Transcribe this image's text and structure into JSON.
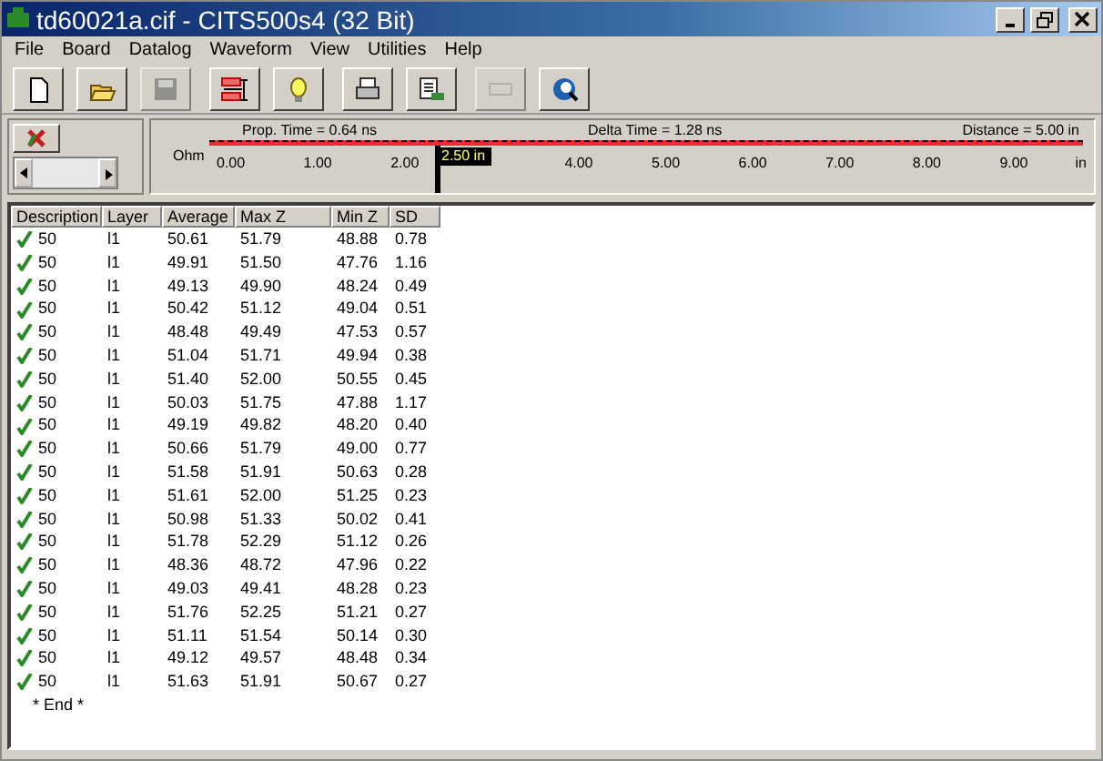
{
  "window": {
    "title": "td60021a.cif - CITS500s4 (32 Bit)"
  },
  "menu": [
    "File",
    "Board",
    "Datalog",
    "Waveform",
    "View",
    "Utilities",
    "Help"
  ],
  "toolbar": [
    {
      "kind": "new",
      "disabled": false
    },
    {
      "kind": "open",
      "disabled": false
    },
    {
      "kind": "save",
      "disabled": true
    },
    {
      "kind": "measure",
      "disabled": false
    },
    {
      "kind": "bulb",
      "disabled": false
    },
    {
      "kind": "print",
      "disabled": false
    },
    {
      "kind": "report",
      "disabled": false
    },
    {
      "kind": "blank",
      "disabled": true
    },
    {
      "kind": "zoom",
      "disabled": false
    }
  ],
  "waveform": {
    "prop_time": "Prop. Time = 0.64 ns",
    "delta_time": "Delta Time = 1.28 ns",
    "distance": "Distance = 5.00 in",
    "y_unit": "Ohm",
    "ticks_before_cursor": [
      "0.00",
      "1.00",
      "2.00"
    ],
    "ticks_after_cursor": [
      "4.00",
      "5.00",
      "6.00",
      "7.00",
      "8.00",
      "9.00"
    ],
    "x_unit": "in",
    "cursor": {
      "label": "2.50 in",
      "level": 0.25
    }
  },
  "table": {
    "columns": [
      "Description",
      "Layer",
      "Average",
      "Max Z",
      "Min Z",
      "SD"
    ],
    "rows": [
      {
        "pass": true,
        "cells": [
          "50",
          "l1",
          "50.61",
          "51.79",
          "48.88",
          "0.78"
        ]
      },
      {
        "pass": true,
        "cells": [
          "50",
          "l1",
          "49.91",
          "51.50",
          "47.76",
          "1.16"
        ]
      },
      {
        "pass": true,
        "cells": [
          "50",
          "l1",
          "49.13",
          "49.90",
          "48.24",
          "0.49"
        ]
      },
      {
        "pass": true,
        "cells": [
          "50",
          "l1",
          "50.42",
          "51.12",
          "49.04",
          "0.51"
        ]
      },
      {
        "pass": true,
        "cells": [
          "50",
          "l1",
          "48.48",
          "49.49",
          "47.53",
          "0.57"
        ]
      },
      {
        "pass": true,
        "cells": [
          "50",
          "l1",
          "51.04",
          "51.71",
          "49.94",
          "0.38"
        ]
      },
      {
        "pass": true,
        "cells": [
          "50",
          "l1",
          "51.40",
          "52.00",
          "50.55",
          "0.45"
        ]
      },
      {
        "pass": true,
        "cells": [
          "50",
          "l1",
          "50.03",
          "51.75",
          "47.88",
          "1.17"
        ]
      },
      {
        "pass": true,
        "cells": [
          "50",
          "l1",
          "49.19",
          "49.82",
          "48.20",
          "0.40"
        ]
      },
      {
        "pass": true,
        "cells": [
          "50",
          "l1",
          "50.66",
          "51.79",
          "49.00",
          "0.77"
        ]
      },
      {
        "pass": true,
        "cells": [
          "50",
          "l1",
          "51.58",
          "51.91",
          "50.63",
          "0.28"
        ]
      },
      {
        "pass": true,
        "cells": [
          "50",
          "l1",
          "51.61",
          "52.00",
          "51.25",
          "0.23"
        ]
      },
      {
        "pass": true,
        "cells": [
          "50",
          "l1",
          "50.98",
          "51.33",
          "50.02",
          "0.41"
        ]
      },
      {
        "pass": true,
        "cells": [
          "50",
          "l1",
          "51.78",
          "52.29",
          "51.12",
          "0.26"
        ]
      },
      {
        "pass": true,
        "cells": [
          "50",
          "l1",
          "48.36",
          "48.72",
          "47.96",
          "0.22"
        ]
      },
      {
        "pass": true,
        "cells": [
          "50",
          "l1",
          "49.03",
          "49.41",
          "48.28",
          "0.23"
        ]
      },
      {
        "pass": true,
        "cells": [
          "50",
          "l1",
          "51.76",
          "52.25",
          "51.21",
          "0.27"
        ]
      },
      {
        "pass": true,
        "cells": [
          "50",
          "l1",
          "51.11",
          "51.54",
          "50.14",
          "0.30"
        ]
      },
      {
        "pass": true,
        "cells": [
          "50",
          "l1",
          "49.12",
          "49.57",
          "48.48",
          "0.34"
        ]
      },
      {
        "pass": true,
        "cells": [
          "50",
          "l1",
          "51.63",
          "51.91",
          "50.67",
          "0.27"
        ]
      }
    ],
    "end_marker": "* End *"
  }
}
